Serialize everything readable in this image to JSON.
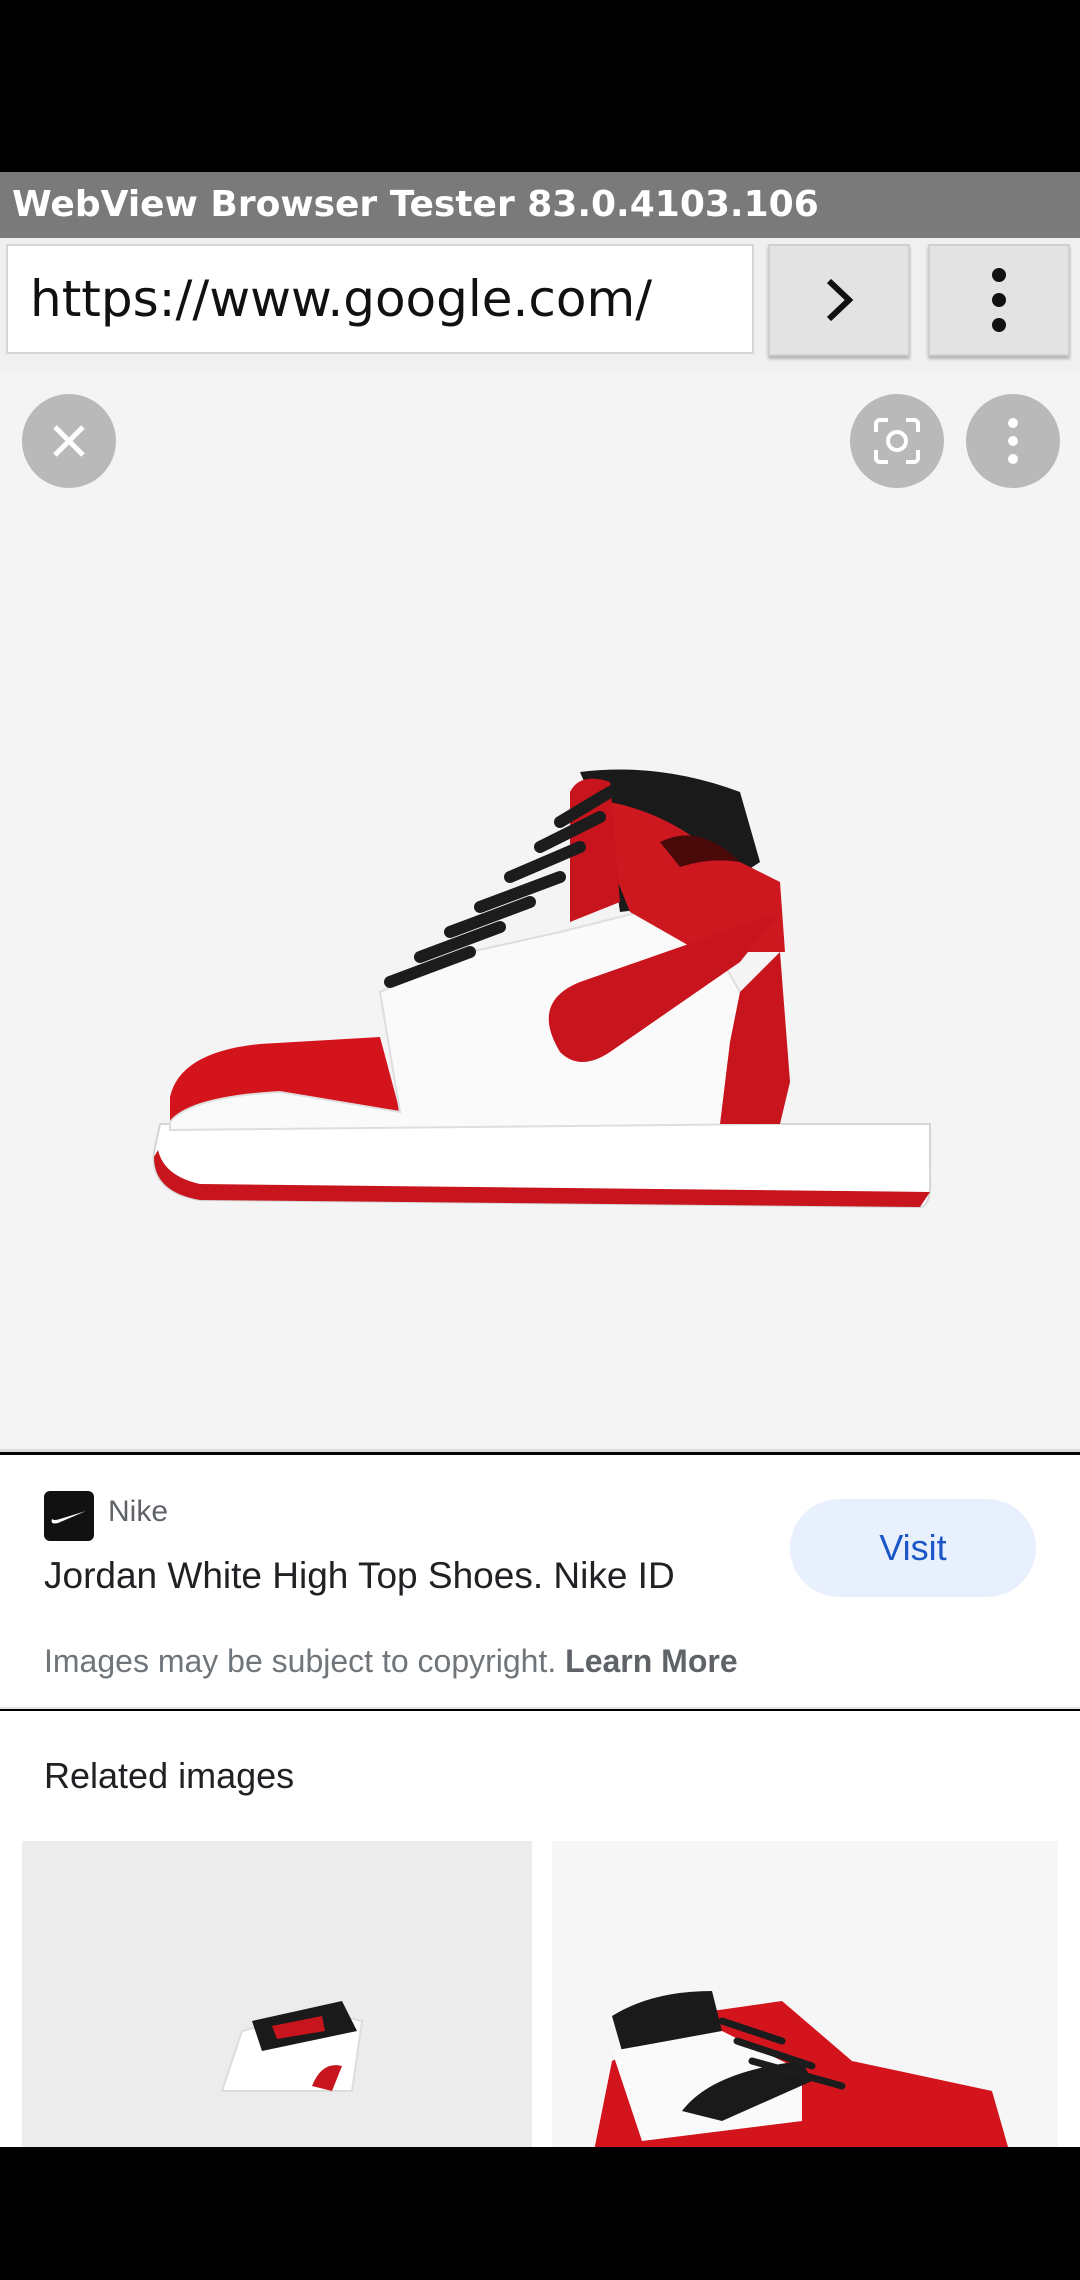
{
  "app": {
    "title": "WebView Browser Tester 83.0.4103.106"
  },
  "url_bar": {
    "value": "https://www.google.com/"
  },
  "viewer": {
    "close_icon": "close-icon",
    "lens_icon": "lens-icon",
    "more_icon": "more-vert-icon"
  },
  "result": {
    "source": "Nike",
    "title": "Jordan White High Top Shoes. Nike ID",
    "visit_label": "Visit",
    "copyright_text": "Images may be subject to copyright. ",
    "learn_more": "Learn More"
  },
  "related": {
    "heading": "Related images"
  },
  "colors": {
    "accent": "#1a56c5",
    "visit_bg": "#e8f0fe",
    "shoe_red": "#c8141c"
  }
}
